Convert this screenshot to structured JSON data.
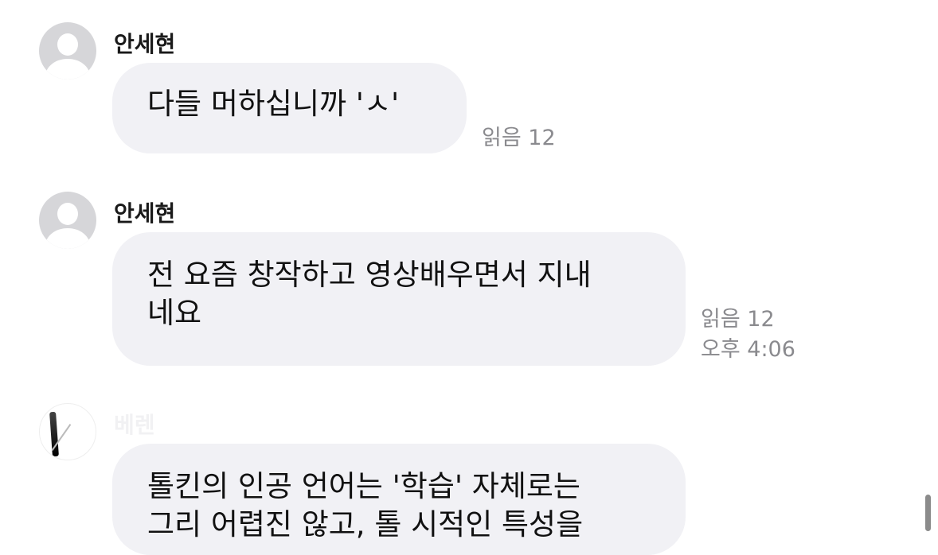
{
  "messages": [
    {
      "sender": "안세현",
      "text": "다들 머하십니까 'ㅅ'",
      "read": "읽음 12",
      "time": ""
    },
    {
      "sender": "안세현",
      "text": "전 요즘 창작하고 영상배우면서 지내\n네요",
      "read": "읽음 12",
      "time": "오후 4:06"
    },
    {
      "sender": "베렌",
      "text": "톨킨의 인공 언어는 '학습' 자체로는\n그리 어렵진 않고, 톨 시적인 특성을",
      "read": "",
      "time": ""
    }
  ]
}
